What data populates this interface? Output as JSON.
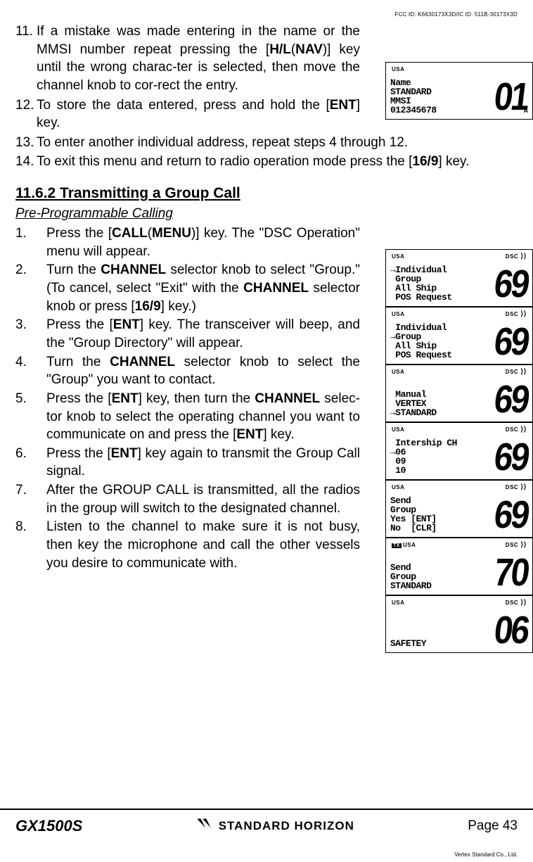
{
  "fcc": "FCC ID: K6630173X3D/IC ID: 511B-30173X3D",
  "vendor_line": "Vertex Standard Co., Ltd.",
  "items_top": [
    {
      "n": "11.",
      "html": "If a mistake was made entering in the name or the MMSI number repeat pressing the [<b>H/L</b>(<b>NAV</b>)] key until the wrong charac-ter is selected, then move the channel knob to cor-rect the entry.",
      "narrow": true
    },
    {
      "n": "12.",
      "html": "To store the data entered, press and hold the [<b>ENT</b>] key.",
      "narrow": true
    },
    {
      "n": "13.",
      "html": "To enter another individual address, repeat steps 4 through 12.",
      "narrow": false
    },
    {
      "n": "14.",
      "html": "To exit this menu and return to radio operation mode press the [<b>16/9</b>] key.",
      "narrow": false
    }
  ],
  "section_heading": "11.6.2 Transmitting a Group Call",
  "sub_heading": "Pre-Programmable Calling",
  "steps": [
    {
      "n": "1.",
      "html": "Press the [<b>CALL</b>(<b>MENU</b>)] key. The \"<span class='osd'>DSC Operation</span>\" menu will appear."
    },
    {
      "n": "2.",
      "html": "Turn the <b>CHANNEL</b> selector knob to select \"<span class='osd'>Group</span>.\" (To cancel, select \"<span class='osd'>Exit</span>\" with the <b>CHANNEL</b> selector knob or press [<b>16/9</b>] key.)"
    },
    {
      "n": "3.",
      "html": "Press the [<b>ENT</b>] key. The transceiver will beep, and the \"<span class='osd'>Group Directory</span>\" will appear."
    },
    {
      "n": "4.",
      "html": "Turn the <b>CHANNEL</b> selector knob to select the \"<span class='osd'>Group</span>\" you want to contact."
    },
    {
      "n": "5.",
      "html": "Press the [<b>ENT</b>] key, then turn the <b>CHANNEL</b> selec-tor knob to select the operating channel you want to communicate on and press the [<b>ENT</b>] key."
    },
    {
      "n": "6.",
      "html": "Press the [<b>ENT</b>] key again to transmit the Group Call signal."
    },
    {
      "n": "7.",
      "html": "After the GROUP CALL is transmitted, all the radios in the group will switch to the designated channel."
    },
    {
      "n": "8.",
      "html": "Listen to the channel to make sure it is not busy, then key the microphone and call the other vessels you desire to communicate with."
    }
  ],
  "lcd_top_single": {
    "usa": "USA",
    "dsc": "",
    "lines": "Name\nSTANDARD\nMMSI\n012345678",
    "big": "01",
    "sub": "A",
    "tx": false
  },
  "lcd_stack": [
    {
      "usa": "USA",
      "dsc": "DSC",
      "lines": "→Individual\n Group\n All Ship\n POS Request",
      "big": "69",
      "tx": false
    },
    {
      "usa": "USA",
      "dsc": "DSC",
      "lines": " Individual\n→Group\n All Ship\n POS Request",
      "big": "69",
      "tx": false
    },
    {
      "usa": "USA",
      "dsc": "DSC",
      "lines": "\n Manual\n VERTEX\n→STANDARD",
      "big": "69",
      "tx": false
    },
    {
      "usa": "USA",
      "dsc": "DSC",
      "lines": " Intership CH\n→06\n 09\n 10",
      "big": "69",
      "tx": false
    },
    {
      "usa": "USA",
      "dsc": "DSC",
      "lines": "Send\nGroup\nYes [ENT]\nNo  [CLR]",
      "big": "69",
      "tx": false
    },
    {
      "usa": "USA",
      "dsc": "DSC",
      "lines": "Send\nGroup\nSTANDARD\n",
      "big": "70",
      "tx": true
    },
    {
      "usa": "USA",
      "dsc": "DSC",
      "lines": "\n\n\nSAFETEY",
      "big": "06",
      "tx": false
    }
  ],
  "footer": {
    "left": "GX1500S",
    "brand": "STANDARD HORIZON",
    "right": "Page 43"
  }
}
